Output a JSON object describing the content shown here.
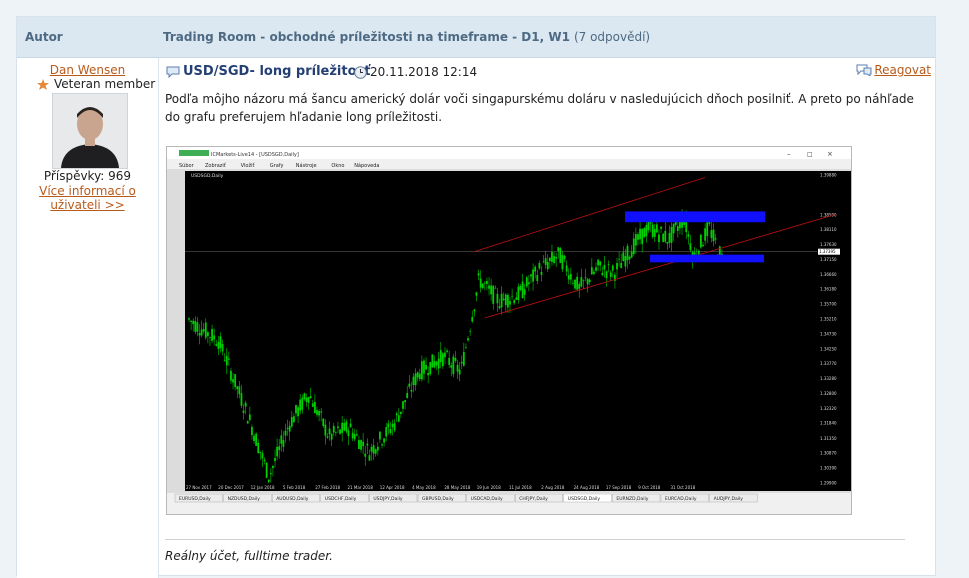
{
  "header": {
    "author_col": "Autor",
    "topic": "Trading Room - obchodné príležitosti na timeframe - D1, W1",
    "reply_count": "(7 odpovědí)"
  },
  "author": {
    "name": "Dan Wensen",
    "rank": "Veteran member",
    "posts": "Příspěvky: 969",
    "more_link": "Více informací o uživateli >>"
  },
  "post": {
    "subject": "USD/SGD- long príležitosť",
    "date": "20.11.2018 12:14",
    "react": "Reagovat",
    "body": "Podľa môjho názoru má šancu americký dolár voči singapurskému doláru v nasledujúcich dňoch posilniť. A preto po náhľade do grafu preferujem hľadanie long príležitosti.",
    "signature": "Reálny účet, fulltime trader."
  },
  "screenshot": {
    "window_title": "ICMarkets-Live14 - [USDSGD,Daily]",
    "menu": [
      "Súbor",
      "Zobraziť",
      "Vložiť",
      "Grafy",
      "Nástroje",
      "Okno",
      "Nápoveda"
    ],
    "chart_label": "USDSGD,Daily",
    "price_ticks": [
      "1.39880",
      "1.38590",
      "1.38110",
      "1.37630",
      "1.37150",
      "1.36660",
      "1.36180",
      "1.35700",
      "1.35210",
      "1.34730",
      "1.34250",
      "1.33770",
      "1.33280",
      "1.32800",
      "1.32320",
      "1.31840",
      "1.31350",
      "1.30870",
      "1.30390",
      "1.29900"
    ],
    "current_price": "1.37395",
    "date_ticks": [
      "27 Nov 2017",
      "20 Dec 2017",
      "12 Jan 2018",
      "5 Feb 2018",
      "27 Feb 2018",
      "21 Mar 2018",
      "12 Apr 2018",
      "4 May 2018",
      "28 May 2018",
      "19 Jun 2018",
      "11 Jul 2018",
      "2 Aug 2018",
      "24 Aug 2018",
      "17 Sep 2018",
      "9 Oct 2018",
      "31 Oct 2018"
    ],
    "tabs": [
      "EURUSD,Daily",
      "NZDUSD,Daily",
      "AUDUSD,Daily",
      "USDCHF,Daily",
      "USDJPY,Daily",
      "GBPUSD,Daily",
      "USDCAD,Daily",
      "CHFJPY,Daily",
      "USDSGD,Daily",
      "EURNZD,Daily",
      "EURCAD,Daily",
      "AUDJPY,Daily"
    ],
    "active_tab": "USDSGD,Daily",
    "colors": {
      "candle": "#00d000",
      "zone": "#1010ff",
      "channel": "#c01010",
      "bg": "#000000"
    }
  }
}
